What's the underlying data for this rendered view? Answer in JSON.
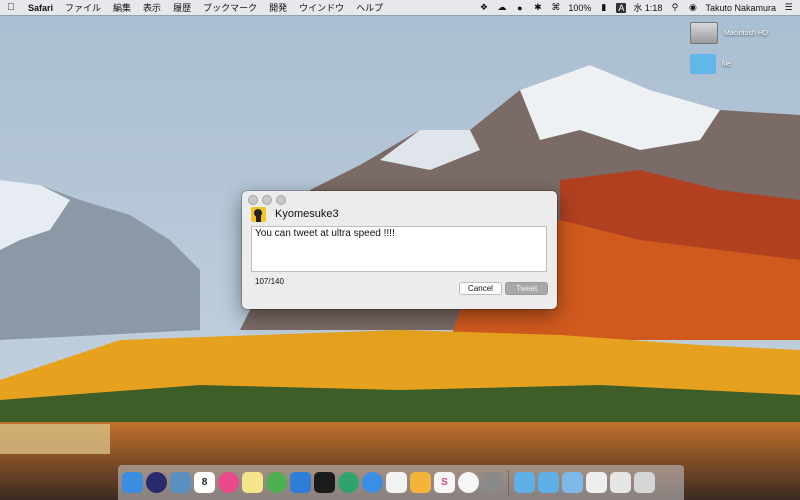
{
  "menubar": {
    "app_name": "Safari",
    "items": [
      "ファイル",
      "編集",
      "表示",
      "履歴",
      "ブックマーク",
      "開発",
      "ウインドウ",
      "ヘルプ"
    ],
    "battery": "100%",
    "input_source": "A",
    "clock": "水 1:18",
    "user": "Takuto Nakamura",
    "icons": [
      "apple-icon",
      "dropbox-icon",
      "cloud-icon",
      "creative-cloud-icon",
      "bluetooth-icon",
      "wifi-icon",
      "spotlight-icon",
      "siri-icon"
    ]
  },
  "desktop": {
    "icons": [
      {
        "label": "Macintosh HD",
        "icon": "hard-drive-icon"
      },
      {
        "label": "file",
        "icon": "folder-icon"
      }
    ]
  },
  "tweet_window": {
    "username": "Kyomesuke3",
    "tweet_text": "You can tweet at ultra speed !!!!",
    "counter": "107/140",
    "cancel_label": "Cancel",
    "tweet_label": "Tweet"
  },
  "dock": {
    "apps": [
      {
        "name": "finder-icon",
        "color": "#3b8de0"
      },
      {
        "name": "siri-icon",
        "color": "#2a2a6e"
      },
      {
        "name": "preview-icon",
        "color": "#5a8fbe"
      },
      {
        "name": "calendar-icon",
        "color": "#ffffff",
        "text": "8"
      },
      {
        "name": "itunes-icon",
        "color": "#e84a8a"
      },
      {
        "name": "notes-icon",
        "color": "#f5e58a"
      },
      {
        "name": "android-studio-icon",
        "color": "#4caf50"
      },
      {
        "name": "xcode-icon",
        "color": "#2e7dd6"
      },
      {
        "name": "terminal-icon",
        "color": "#1b1b1b"
      },
      {
        "name": "atom-icon",
        "color": "#2fa36b"
      },
      {
        "name": "safari-icon",
        "color": "#3a8ee6"
      },
      {
        "name": "numbers-icon",
        "color": "#f2f2f2"
      },
      {
        "name": "sketch-icon",
        "color": "#f4b43a"
      },
      {
        "name": "slack-icon",
        "color": "#f6f6f6",
        "text": "S"
      },
      {
        "name": "photos-icon",
        "color": "#f7f7f7"
      },
      {
        "name": "system-preferences-icon",
        "color": "#8a8a8a"
      },
      {
        "name": "downloads-folder-icon",
        "color": "#5fb0e6"
      },
      {
        "name": "applications-folder-icon",
        "color": "#5fb0e6"
      },
      {
        "name": "documents-stack-icon",
        "color": "#7eb9e9"
      },
      {
        "name": "mail-stack-icon",
        "color": "#eeeeee"
      },
      {
        "name": "window-stack-icon",
        "color": "#e6e6e6"
      },
      {
        "name": "trash-icon",
        "color": "#d6d6d6"
      }
    ]
  }
}
